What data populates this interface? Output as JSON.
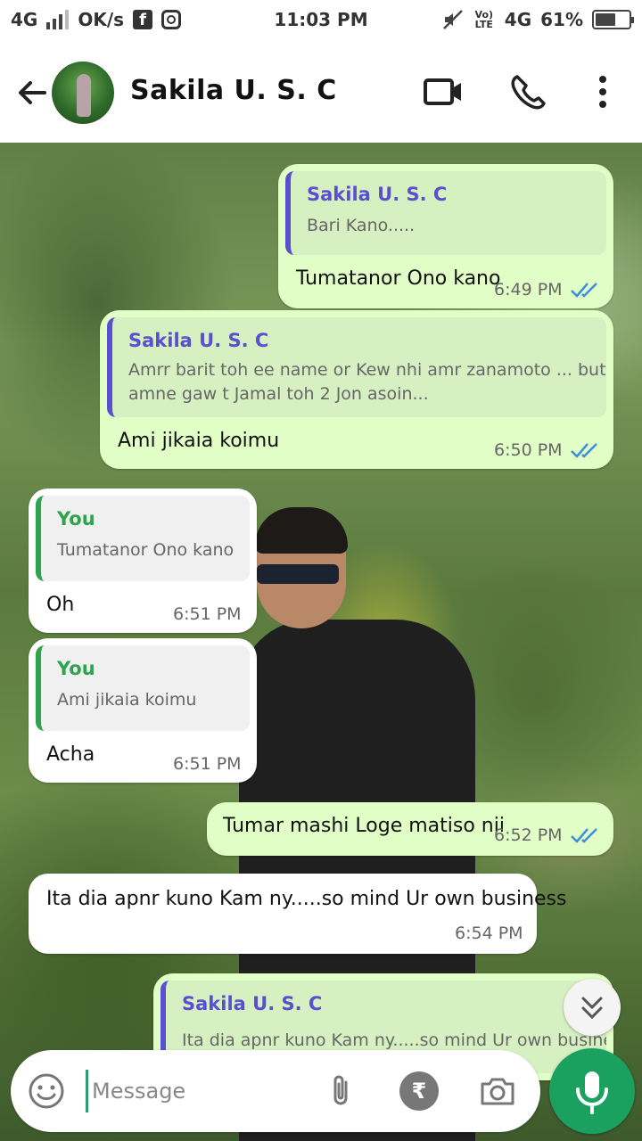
{
  "status_bar": {
    "network_left": "4G",
    "speed": "OK/s",
    "time": "11:03 PM",
    "volte": "Vo) LTE",
    "network_right": "4G",
    "battery": "61%",
    "battery_level": 0.61,
    "icons": [
      "signal-icon",
      "facebook-icon",
      "instagram-icon",
      "mute-icon",
      "battery-icon"
    ]
  },
  "header": {
    "contact_name": "Sakila U. S. C",
    "icons": [
      "back-arrow-icon",
      "avatar",
      "video-call-icon",
      "voice-call-icon",
      "more-options-icon"
    ]
  },
  "messages": [
    {
      "dir": "out",
      "quote_name": "Sakila U. S. C",
      "quote_lines": [
        "Bari Kano....."
      ],
      "text": "Tumatanor Ono kano",
      "time": "6:49 PM",
      "read": true
    },
    {
      "dir": "out",
      "quote_name": "Sakila U. S. C",
      "quote_lines": [
        "Amrr barit toh ee name or Kew nhi amr zanamoto ... but",
        "amne gaw t Jamal toh 2 Jon asoin..."
      ],
      "text": "Ami jikaia koimu",
      "time": "6:50 PM",
      "read": true
    },
    {
      "dir": "in",
      "quote_name": "You",
      "quote_lines": [
        "Tumatanor Ono kano"
      ],
      "text": "Oh",
      "time": "6:51 PM"
    },
    {
      "dir": "in",
      "quote_name": "You",
      "quote_lines": [
        "Ami jikaia koimu"
      ],
      "text": "Acha",
      "time": "6:51 PM"
    },
    {
      "dir": "out",
      "text": "Tumar mashi Loge matiso nii",
      "time": "6:52 PM",
      "read": true
    },
    {
      "dir": "in",
      "text": "Ita dia apnr kuno Kam ny.....so mind Ur own business",
      "time": "6:54 PM"
    },
    {
      "dir": "out",
      "quote_name": "Sakila U. S. C",
      "quote_lines": [
        "Ita dia apnr kuno Kam ny.....so mind Ur own business"
      ]
    }
  ],
  "input": {
    "placeholder": "Message",
    "icons": [
      "emoji-icon",
      "attach-icon",
      "rupee-payment-icon",
      "camera-icon",
      "mic-icon",
      "scroll-down-icon"
    ]
  },
  "colors": {
    "outgoing_bubble": "#e1fec6",
    "incoming_bubble": "#ffffff",
    "quote_name_out": "#5a4fd0",
    "quote_name_in": "#2ea44f",
    "read_ticks": "#3b8fdc",
    "mic_button": "#1aa160"
  }
}
